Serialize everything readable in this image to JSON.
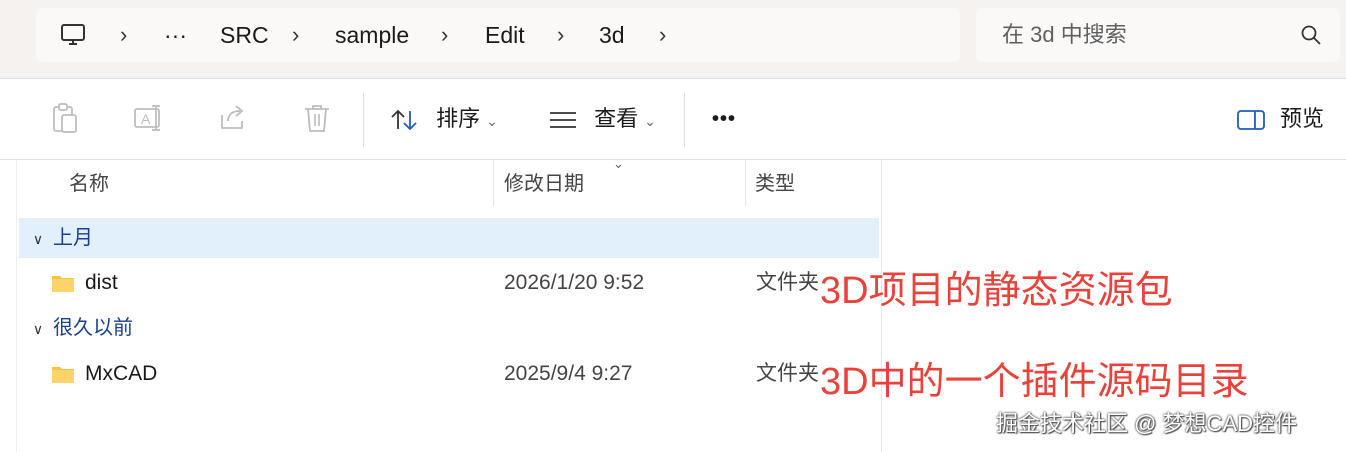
{
  "address": {
    "items": [
      "SRC",
      "sample",
      "Edit",
      "3d"
    ],
    "ellipsis": "···",
    "sep": "›"
  },
  "search": {
    "placeholder": "在 3d 中搜索"
  },
  "commands": {
    "sort": "排序",
    "view": "查看",
    "more": "•••",
    "preview": "预览"
  },
  "columns": {
    "name": "名称",
    "modified": "修改日期",
    "type": "类型"
  },
  "groups": [
    {
      "label": "上月",
      "files": [
        {
          "name": "dist",
          "modified": "2026/1/20 9:52",
          "type": "文件夹"
        }
      ]
    },
    {
      "label": "很久以前",
      "files": [
        {
          "name": "MxCAD",
          "modified": "2025/9/4 9:27",
          "type": "文件夹"
        }
      ]
    }
  ],
  "annotations": [
    "3D项目的静态资源包",
    "3D中的一个插件源码目录"
  ],
  "watermark": "掘金技术社区 @ 梦想CAD控件",
  "colors": {
    "accent": "#e8433b",
    "group_text": "#1b3f8b",
    "selection": "#e1f0fb",
    "folder": "#f6c343"
  }
}
